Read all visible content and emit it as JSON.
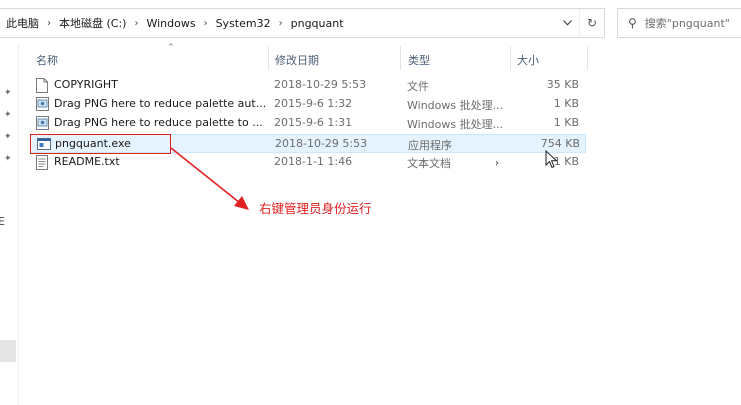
{
  "address": {
    "crumbs": [
      "此电脑",
      "本地磁盘 (C:)",
      "Windows",
      "System32",
      "pngquant"
    ],
    "dropdown_icon": "chevron-down-icon",
    "refresh_icon": "refresh-icon"
  },
  "search": {
    "placeholder": "搜索\"pngquant\""
  },
  "columns": {
    "name": "名称",
    "date": "修改日期",
    "type": "类型",
    "size": "大小"
  },
  "files": [
    {
      "name": "COPYRIGHT",
      "date": "2018-10-29 5:53",
      "type": "文件",
      "size": "35 KB",
      "icon": "file-icon"
    },
    {
      "name": "Drag PNG here to reduce palette aut...",
      "date": "2015-9-6 1:32",
      "type": "Windows 批处理...",
      "size": "1 KB",
      "icon": "batch-file-icon"
    },
    {
      "name": "Drag PNG here to reduce palette to ...",
      "date": "2015-9-6 1:31",
      "type": "Windows 批处理...",
      "size": "1 KB",
      "icon": "batch-file-icon"
    },
    {
      "name": "pngquant.exe",
      "date": "2018-10-29 5:53",
      "type": "应用程序",
      "size": "754 KB",
      "icon": "exe-icon"
    },
    {
      "name": "README.txt",
      "date": "2018-1-1 1:46",
      "type": "文本文档",
      "size": "1 KB",
      "icon": "text-file-icon"
    }
  ],
  "annotation": {
    "text": "右键管理员身份运行",
    "color": "#e02020"
  },
  "colors": {
    "accent_highlight": "#e5f3ff",
    "header_text": "#4c607a",
    "annotation_red": "#e02020"
  }
}
